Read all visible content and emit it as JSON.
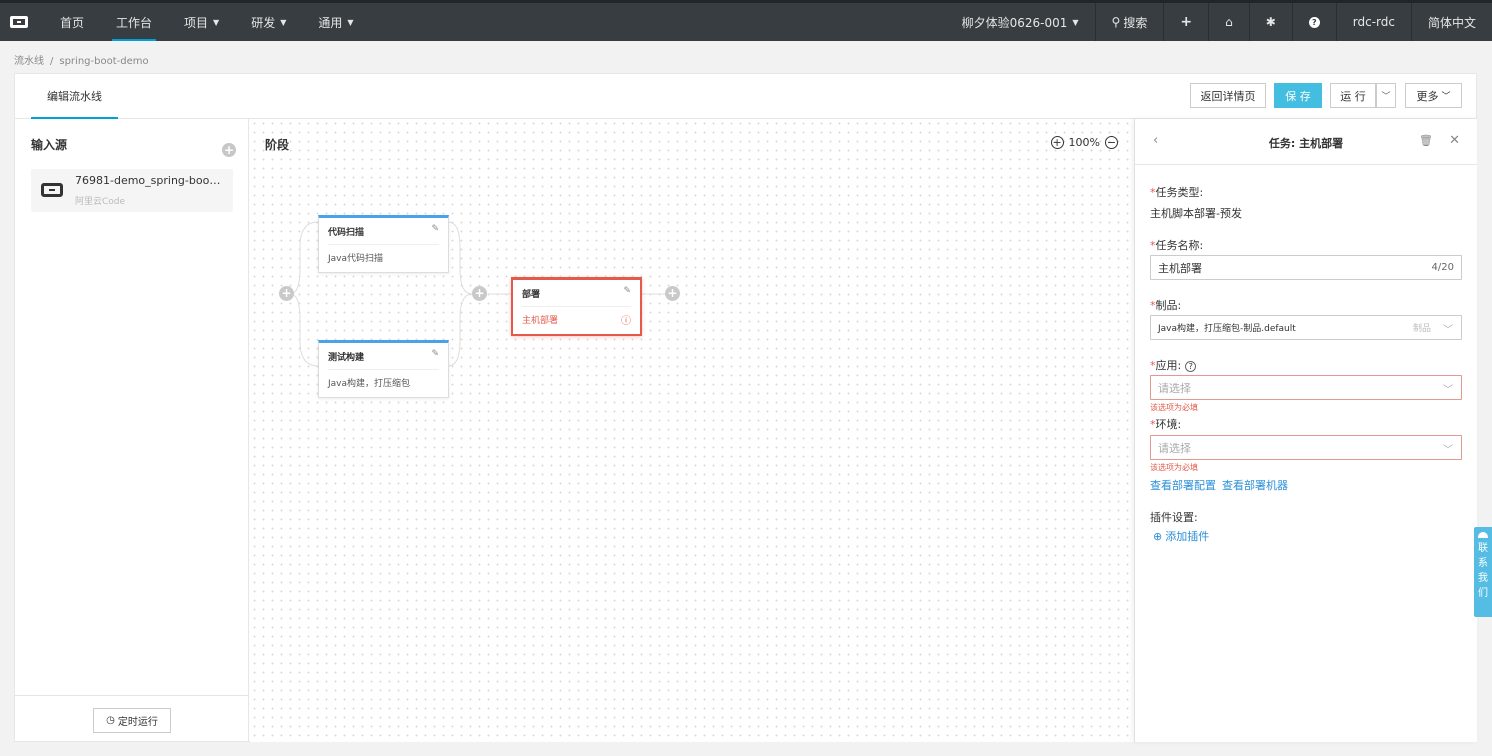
{
  "topnav": {
    "items": [
      {
        "label": "首页"
      },
      {
        "label": "工作台"
      },
      {
        "label": "项目"
      },
      {
        "label": "研发"
      },
      {
        "label": "通用"
      }
    ],
    "org": "柳夕体验0626-001",
    "search": "搜索",
    "user": "rdc-rdc",
    "lang": "简体中文"
  },
  "breadcrumb": {
    "root": "流水线",
    "sep": "/",
    "current": "spring-boot-demo"
  },
  "header": {
    "tab": "编辑流水线",
    "back_btn": "返回详情页",
    "save_btn": "保 存",
    "run_btn": "运 行",
    "more_btn": "更多"
  },
  "source": {
    "title": "输入源",
    "item_name": "76981-demo_spring-boo…",
    "item_type": "阿里云Code",
    "timer": "定时运行"
  },
  "stage": {
    "title": "阶段",
    "zoom": "100%",
    "nodes": [
      {
        "name": "代码扫描",
        "desc": "Java代码扫描"
      },
      {
        "name": "测试构建",
        "desc": "Java构建，打压缩包"
      },
      {
        "name": "部署",
        "desc": "主机部署"
      }
    ]
  },
  "panel": {
    "title": "任务: 主机部署",
    "req": "*",
    "task_type_label": "任务类型:",
    "task_type": "主机脚本部署-预发",
    "task_name_label": "任务名称:",
    "task_name": "主机部署",
    "task_name_count": "4/20",
    "artifact_label": "制品:",
    "artifact": "Java构建，打压缩包-制品.default",
    "artifact_hint": "制品",
    "app_label": "应用:",
    "app_placeholder": "请选择",
    "app_error": "该选项为必填",
    "env_label": "环境:",
    "env_placeholder": "请选择",
    "env_error": "该选项为必填",
    "link_config": "查看部署配置",
    "link_machine": "查看部署机器",
    "plugin_label": "插件设置:",
    "add_plugin": "添加插件"
  },
  "contact": "联系我们",
  "colors": {
    "accent": "#43bde0",
    "error": "#e45a4a",
    "nav": "#373d41",
    "node_top": "#4aa3e8"
  }
}
